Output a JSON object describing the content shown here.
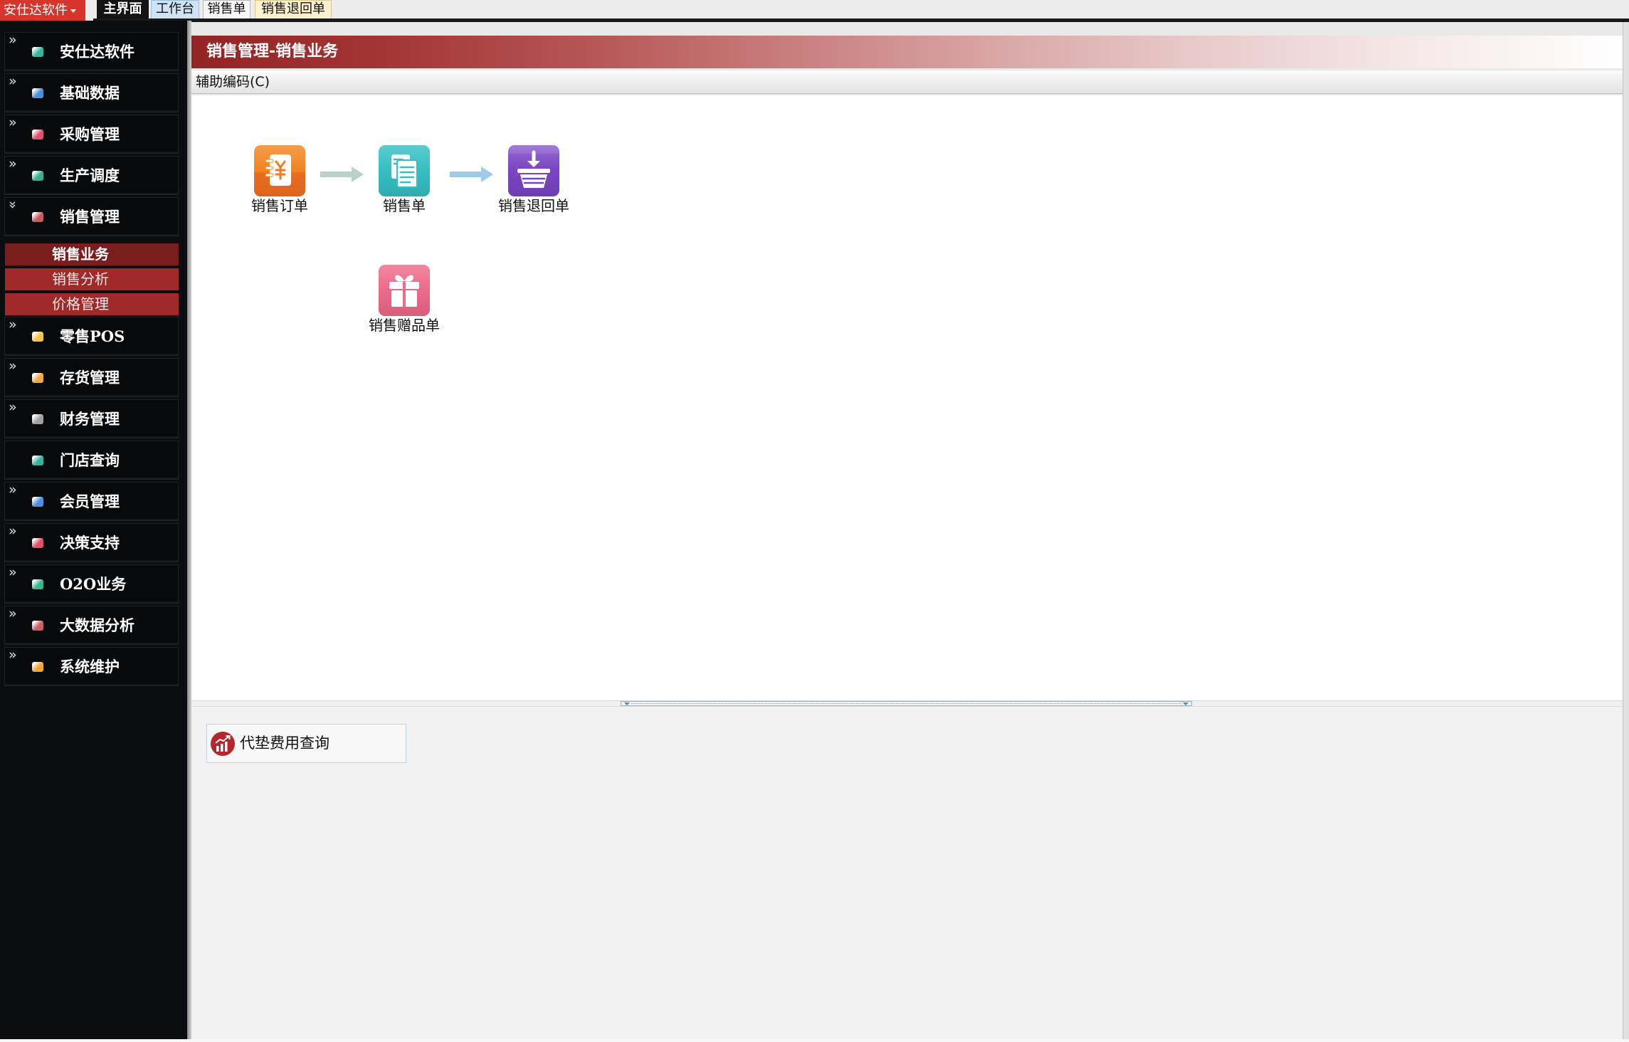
{
  "topbar": {
    "brand_menu": "安仕达软件",
    "brand_caret_icon": "caret-down-icon",
    "tabs": [
      {
        "label": "主界面",
        "active": true
      },
      {
        "label": "工作台",
        "active": false
      },
      {
        "label": "销售单",
        "active": false
      },
      {
        "label": "销售退回单",
        "active": false
      }
    ]
  },
  "sidebar": {
    "items": [
      {
        "label": "安仕达软件",
        "icon": "module-icon",
        "color": "#35b59b"
      },
      {
        "label": "基础数据",
        "icon": "module-icon",
        "color": "#4b8fd8"
      },
      {
        "label": "采购管理",
        "icon": "module-icon",
        "color": "#e2526f"
      },
      {
        "label": "生产调度",
        "icon": "module-icon",
        "color": "#34b08e"
      },
      {
        "label": "销售管理",
        "icon": "module-icon",
        "color": "#c95a60",
        "expanded": true
      },
      {
        "label": "零售POS",
        "icon": "module-icon",
        "color": "#f2c244"
      },
      {
        "label": "存货管理",
        "icon": "module-icon",
        "color": "#f3a645"
      },
      {
        "label": "财务管理",
        "icon": "module-icon",
        "color": "#a0a0a0"
      },
      {
        "label": "门店查询",
        "icon": "module-icon",
        "color": "#36b3a0"
      },
      {
        "label": "会员管理",
        "icon": "module-icon",
        "color": "#4a90d8"
      },
      {
        "label": "决策支持",
        "icon": "module-icon",
        "color": "#e34c6a"
      },
      {
        "label": "O2O业务",
        "icon": "module-icon",
        "color": "#38b68b"
      },
      {
        "label": "大数据分析",
        "icon": "module-icon",
        "color": "#cf5a68"
      },
      {
        "label": "系统维护",
        "icon": "module-icon",
        "color": "#f3a435"
      }
    ],
    "sales_submenu": [
      {
        "label": "销售业务",
        "selected": true
      },
      {
        "label": "销售分析",
        "selected": false
      },
      {
        "label": "价格管理",
        "selected": false
      }
    ]
  },
  "main": {
    "title": "销售管理-销售业务",
    "toolbar_label": "辅助编码(C)",
    "flow_nodes": [
      {
        "label": "销售订单",
        "icon": "sales-order-icon",
        "color": "#f28420"
      },
      {
        "label": "销售单",
        "icon": "sales-document-icon",
        "color": "#35bfc3"
      },
      {
        "label": "销售退回单",
        "icon": "sales-return-basket-icon",
        "color": "#7a45c4"
      },
      {
        "label": "销售赠品单",
        "icon": "gift-icon",
        "color": "#ee6a8a"
      }
    ],
    "quick_query": {
      "label": "代垫费用查询",
      "icon": "chart-icon",
      "color": "#b4252c"
    }
  }
}
